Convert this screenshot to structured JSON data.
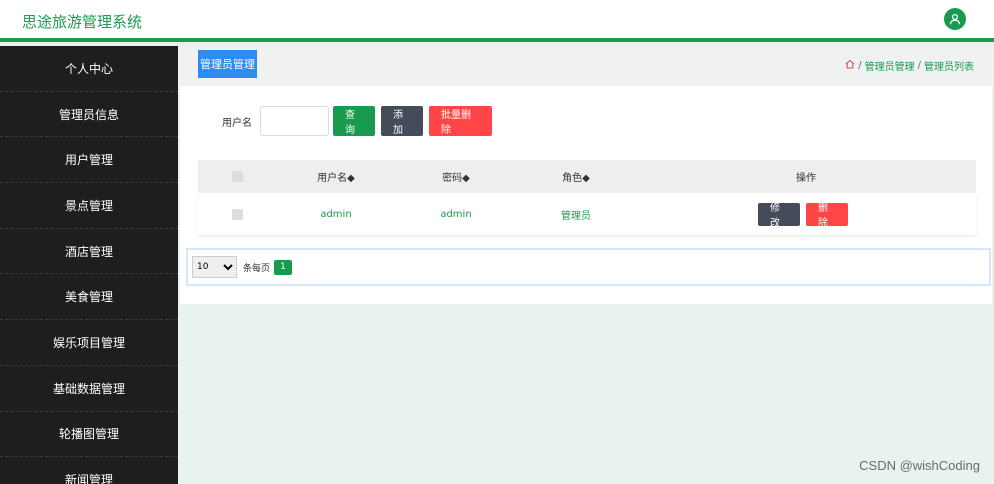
{
  "app": {
    "title": "思途旅游管理系统",
    "accent": "#1a9a4f"
  },
  "sidebar": {
    "items": [
      {
        "label": "个人中心"
      },
      {
        "label": "管理员信息"
      },
      {
        "label": "用户管理"
      },
      {
        "label": "景点管理"
      },
      {
        "label": "酒店管理"
      },
      {
        "label": "美食管理"
      },
      {
        "label": "娱乐项目管理"
      },
      {
        "label": "基础数据管理"
      },
      {
        "label": "轮播图管理"
      },
      {
        "label": "新闻管理"
      }
    ]
  },
  "header": {
    "tab_label": "管理员管理",
    "breadcrumb": {
      "home_icon": "home-icon",
      "level1": "管理员管理",
      "level2": "管理员列表",
      "separator": "/"
    }
  },
  "search": {
    "username_label": "用户名",
    "username_value": "",
    "query_label": "查询",
    "add_label": "添加",
    "batch_delete_label": "批量删除"
  },
  "table": {
    "columns": [
      "用户名◆",
      "密码◆",
      "角色◆",
      "操作"
    ],
    "rows": [
      {
        "username": "admin",
        "password": "admin",
        "role": "管理员",
        "edit_label": "修改",
        "delete_label": "删除"
      }
    ]
  },
  "pagination": {
    "page_size": "10",
    "page_size_options": [
      "10"
    ],
    "per_page_label": "条每页",
    "current_page": "1"
  },
  "watermark": "CSDN @wishCoding"
}
